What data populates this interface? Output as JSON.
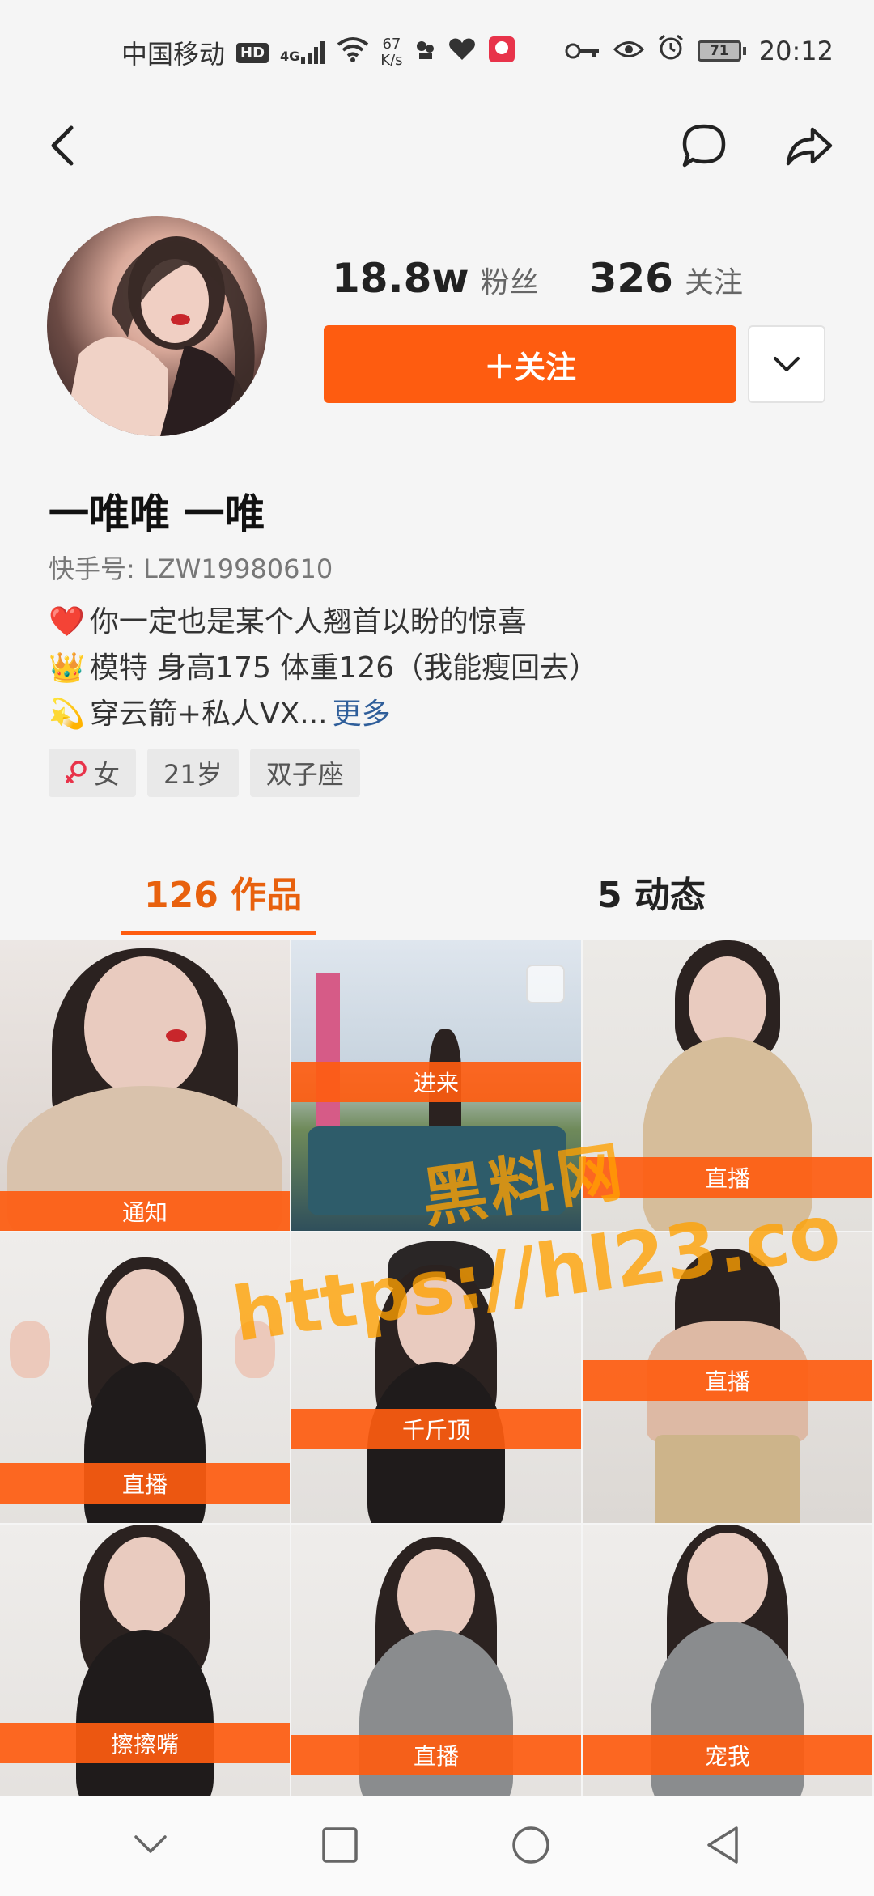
{
  "status_bar": {
    "carrier": "中国移动",
    "hd": "HD",
    "net_type": "4G",
    "speed_value": "67",
    "speed_unit": "K/s",
    "battery": "71",
    "time": "20:12"
  },
  "profile": {
    "followers_count": "18.8w",
    "followers_label": "粉丝",
    "following_count": "326",
    "following_label": "关注",
    "follow_button": "＋关注",
    "name": "一唯唯 一唯",
    "uid": "快手号: LZW19980610",
    "bio": [
      {
        "emoji": "❤️",
        "text": "你一定也是某个人翘首以盼的惊喜"
      },
      {
        "emoji": "👑",
        "text": "模特  身高175 体重126（我能瘦回去）"
      },
      {
        "emoji": "💫",
        "text": "穿云箭+私人VX...",
        "more": "更多"
      }
    ],
    "tags": [
      {
        "icon": "female-icon",
        "text": "女"
      },
      {
        "text": "21岁"
      },
      {
        "text": "双子座"
      }
    ]
  },
  "tabs": [
    {
      "label": "126 作品",
      "active": true
    },
    {
      "label": "5 动态",
      "active": false
    }
  ],
  "grid": [
    {
      "label": "通知"
    },
    {
      "label": "进来"
    },
    {
      "label": "直播"
    },
    {
      "label": "直播"
    },
    {
      "label": "千斤顶"
    },
    {
      "label": "直播"
    },
    {
      "label": "擦擦嘴"
    },
    {
      "label": "直播"
    },
    {
      "label": "宠我"
    }
  ],
  "watermark": {
    "line1": "黑料网",
    "line2": "https://hl23.co"
  },
  "colors": {
    "accent": "#fe5c10",
    "tab_active": "#e8610e",
    "link": "#2f5e9a"
  }
}
